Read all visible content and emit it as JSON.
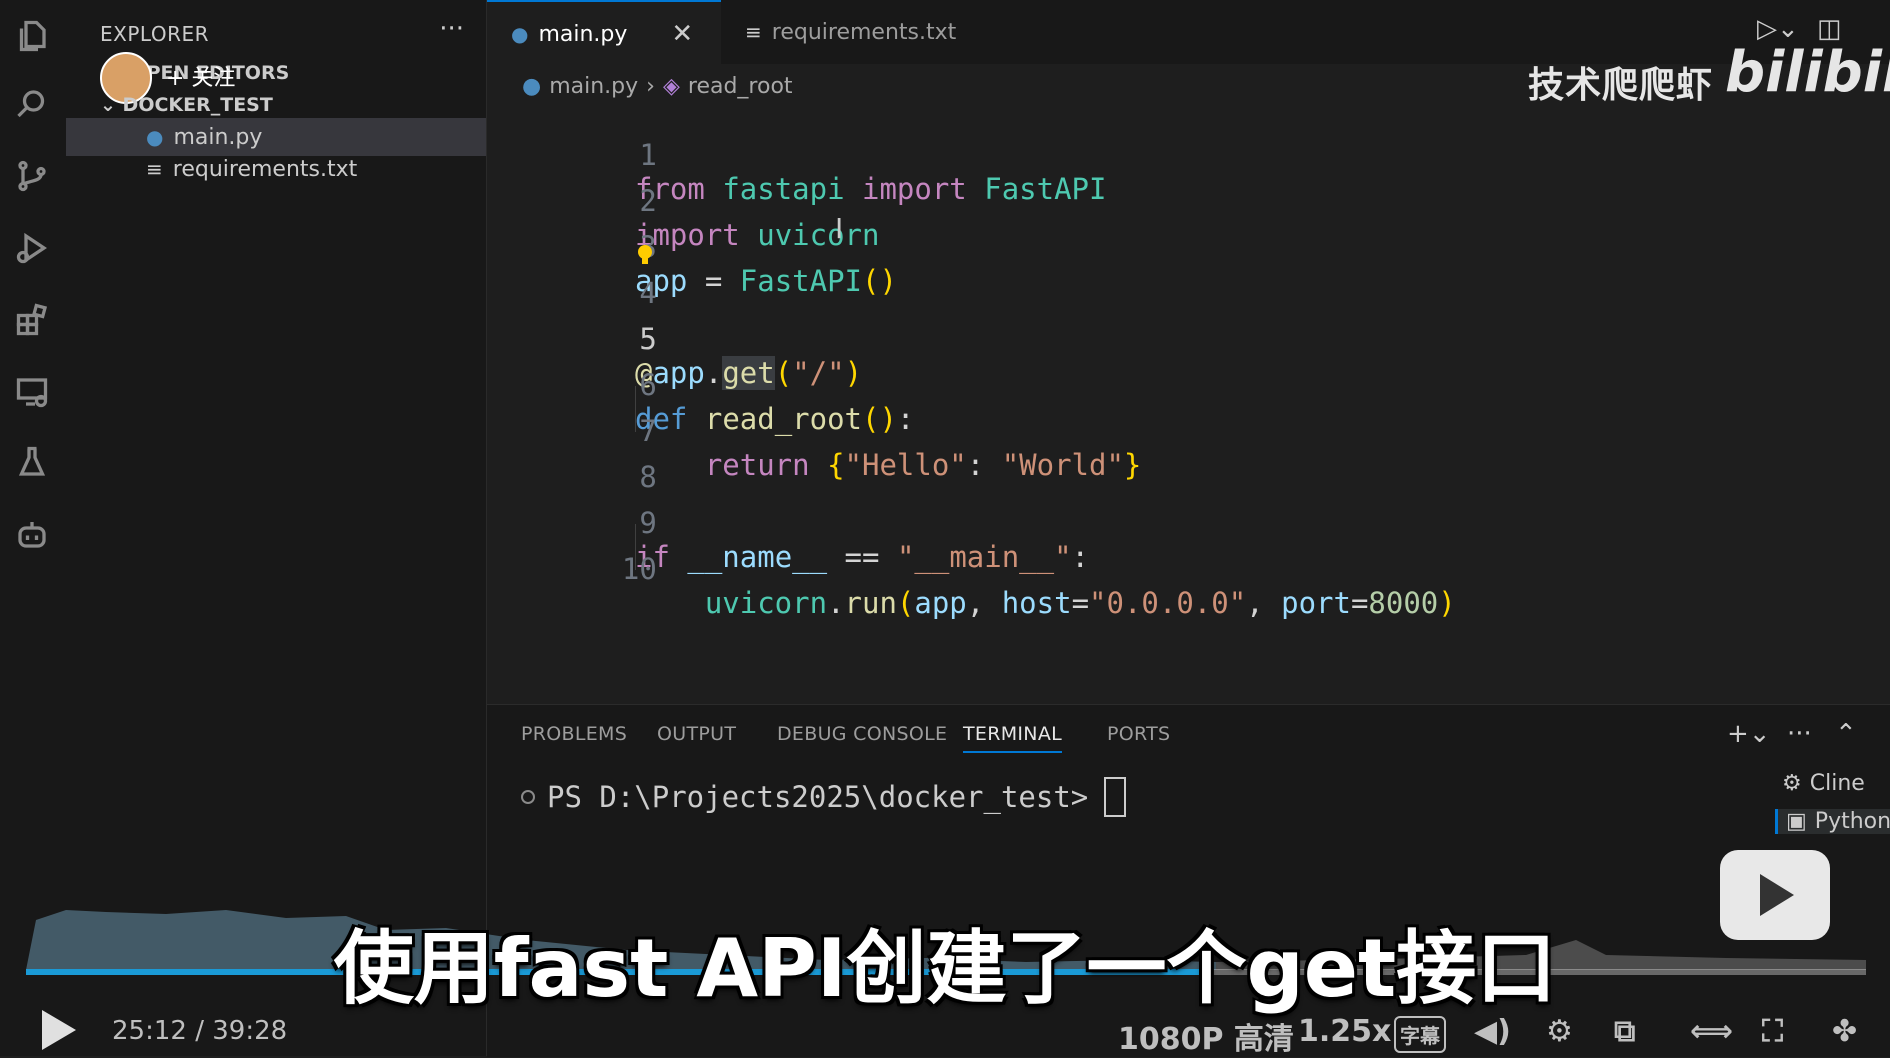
{
  "sidebar": {
    "header": "EXPLORER",
    "more": "···",
    "follow": "+ 关注",
    "open_editors": "OPEN EDITORS",
    "project": "DOCKER_TEST",
    "files": [
      "main.py",
      "requirements.txt"
    ]
  },
  "tabs": [
    {
      "label": "main.py",
      "active": true
    },
    {
      "label": "requirements.txt",
      "active": false
    }
  ],
  "breadcrumb": [
    "main.py",
    "read_root"
  ],
  "editor": {
    "line_numbers": [
      "1",
      "2",
      "3",
      "4",
      "5",
      "6",
      "7",
      "8",
      "9",
      "10"
    ],
    "current_line": "5"
  },
  "watermark": {
    "channel": "技术爬爬虾",
    "brand": "bilibili"
  },
  "panel": {
    "tabs": [
      "PROBLEMS",
      "OUTPUT",
      "DEBUG CONSOLE",
      "TERMINAL",
      "PORTS"
    ],
    "active_tab": "TERMINAL",
    "prompt": "PS D:\\Projects2025\\docker_test>",
    "terminals": [
      "Cline",
      "Python"
    ]
  },
  "player": {
    "subtitle": "使用fast API创建了一个get接口",
    "time_current": "25:12",
    "time_total": "39:28",
    "time_separator": "/",
    "quality": "1080P 高清",
    "speed": "1.25x",
    "subtitle_toggle": "字幕",
    "progress": 0.64
  },
  "colors": {
    "accent": "#0078d4",
    "progress": "#1a9ad6"
  }
}
